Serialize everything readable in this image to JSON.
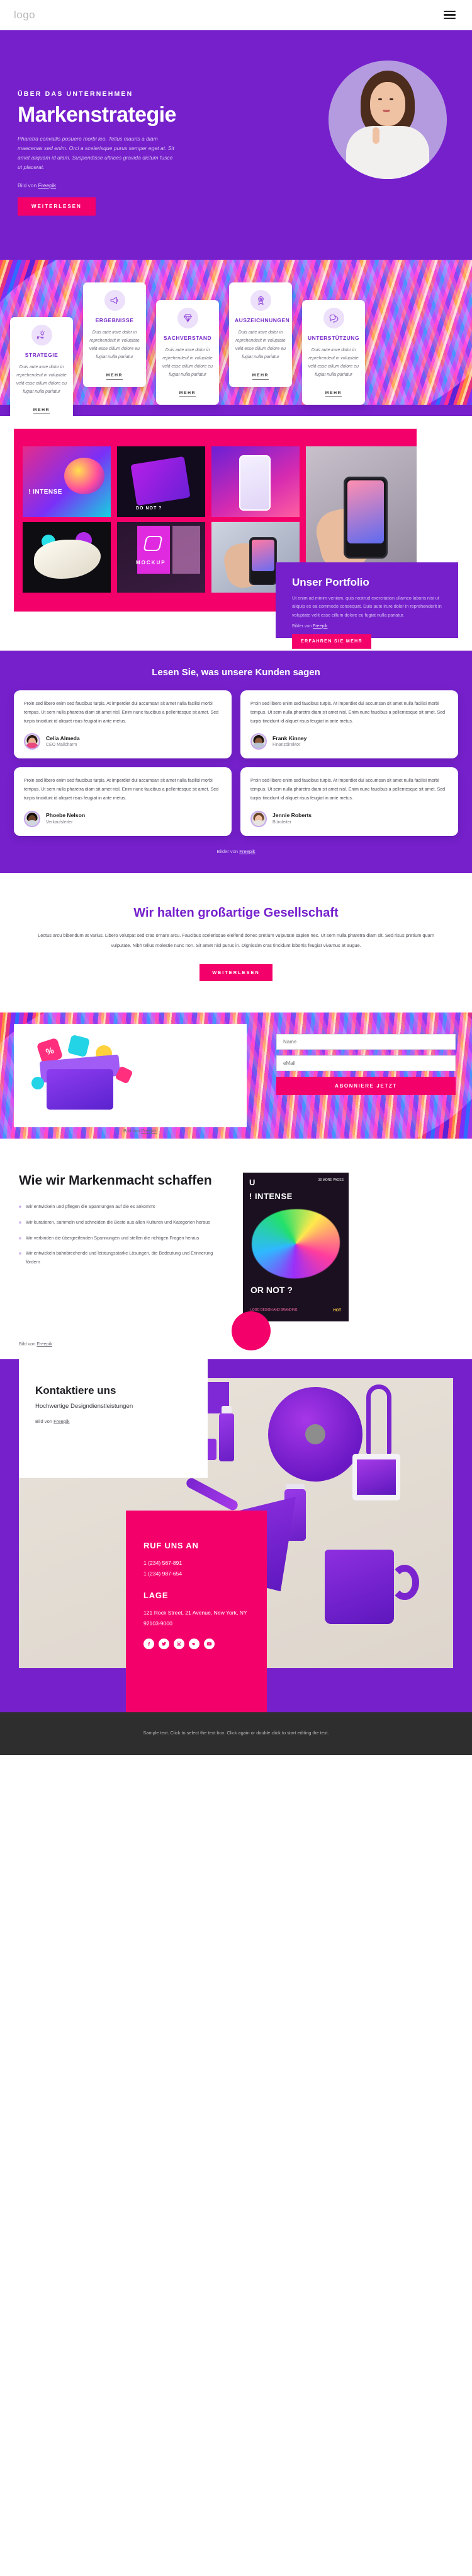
{
  "header": {
    "logo": "logo",
    "menu_icon": "hamburger-menu-icon"
  },
  "hero": {
    "eyebrow": "ÜBER DAS UNTERNEHMEN",
    "title": "Markenstrategie",
    "paragraph": "Pharetra convallis posuere morbi leo. Tellus mauris a diam maecenas sed enim. Orci a scelerisque purus semper eget at. Sit amet aliquam id diam. Suspendisse ultrices gravida dictum fusce ut placerat.",
    "credit_prefix": "Bild von ",
    "credit_link": "Freepik",
    "cta": "WEITERLESEN"
  },
  "features": {
    "body": "Duis aute irure dolor in reprehenderit in voluptate velit esse cillum dolore eu fugiat nulla pariatur",
    "more": "MEHR",
    "items": [
      {
        "title": "STRATEGIE",
        "icon": "lightbulb-hand-icon"
      },
      {
        "title": "ERGEBNISSE",
        "icon": "megaphone-icon"
      },
      {
        "title": "SACHVERSTAND",
        "icon": "diamond-icon"
      },
      {
        "title": "AUSZEICHNUNGEN",
        "icon": "award-ribbon-icon"
      },
      {
        "title": "UNTERSTÜTZUNG",
        "icon": "chat-bubbles-icon"
      }
    ]
  },
  "portfolio": {
    "title": "Unser Portfolio",
    "paragraph": "Ut enim ad minim veniam, quis nostrud exercitation ullamco laboris nisi ut aliquip ex ea commodo consequat. Duis aute irure dolor in reprehenderit in voluptate velit esse cillum dolore eu fugiat nulla pariatur.",
    "credit_prefix": "Bilder von ",
    "credit_link": "Freepik",
    "cta": "ERFAHREN SIE MEHR",
    "tiles": [
      {
        "label": "! INTENSE"
      },
      {
        "label": "DO NOT ?"
      },
      {
        "label": "MOCKUP"
      }
    ]
  },
  "testimonials": {
    "heading": "Lesen Sie, was unsere Kunden sagen",
    "quote": "Proin sed libero enim sed faucibus turpis. At imperdiet dui accumsan sit amet nulla facilisi morbi tempus. Ut sem nulla pharetra diam sit amet nisl. Enim nunc faucibus a pellentesque sit amet. Sed turpis tincidunt id aliquet risus feugiat in ante metus.",
    "credit_prefix": "Bilder von ",
    "credit_link": "Freepik",
    "people": [
      {
        "name": "Celia Almeda",
        "role": "CEO Mailcharm"
      },
      {
        "name": "Frank Kinney",
        "role": "Finanzdirektor"
      },
      {
        "name": "Phoebe Nelson",
        "role": "Verkaufsleiter"
      },
      {
        "name": "Jennie Roberts",
        "role": "Büroleiter"
      }
    ]
  },
  "company": {
    "heading": "Wir halten großartige Gesellschaft",
    "paragraph": "Lectus arcu bibendum at varius. Libero volutpat sed cras ornare arcu. Faucibus scelerisque eleifend donec pretium vulputate sapien nec. Ut sem nulla pharetra diam sit. Sed risus pretium quam vulputate. Nibh tellus molestie nunc non. Sit amet nisl purus in. Dignissim cras tincidunt lobortis feugiat vivamus at augue.",
    "cta": "WEITERLESEN"
  },
  "subscribe": {
    "name_placeholder": "Name",
    "email_placeholder": "eMail",
    "cta": "ABONNIERE JETZT",
    "credit_prefix": "Bild von ",
    "credit_link": "Freepik"
  },
  "brandpower": {
    "heading": "Wie wir Markenmacht schaffen",
    "bullets": [
      "Wir entwickeln und pflegen die Spannungen auf die es ankommt",
      "Wir kuratieren, sammeln und schneiden die Beste aus allen Kulturen und Kategorien heraus",
      "Wir verbinden die übergreifenden Spannungen und stellen die richtigen Fragen heraus",
      "Wir entwickeln bahnbrechende und leistungsstarke Lösungen, die Bedeutung und Erinnerung fördern"
    ],
    "credit_prefix": "Bild von ",
    "credit_link": "Freepik",
    "magazine": {
      "brand": "U",
      "top_note": "30 MORE\nPAGES",
      "title": "! INTENSE",
      "footer_left": "LOGO DESIGN AND BRANDING",
      "footer_right": "HOT",
      "or_not": "OR NOT ?"
    }
  },
  "contact": {
    "heading": "Kontaktiere uns",
    "subheading": "Hochwertige Designdienstleistungen",
    "credit_prefix": "Bild von ",
    "credit_link": "Freepik",
    "call_title": "RUF UNS AN",
    "phones": [
      "1 (234) 567-891",
      "1 (234) 987-654"
    ],
    "location_title": "LAGE",
    "address": "121 Rock Street, 21 Avenue, New York, NY 92103-9000",
    "socials": [
      {
        "name": "facebook-icon"
      },
      {
        "name": "twitter-icon"
      },
      {
        "name": "instagram-icon"
      },
      {
        "name": "vk-icon"
      },
      {
        "name": "youtube-icon"
      }
    ]
  },
  "footer": {
    "text": "Sample text. Click to select the text box. Click again or double click to start editing the text."
  },
  "colors": {
    "purple": "#7620cc",
    "pink": "#f4006b",
    "dark": "#2e2e2e"
  }
}
